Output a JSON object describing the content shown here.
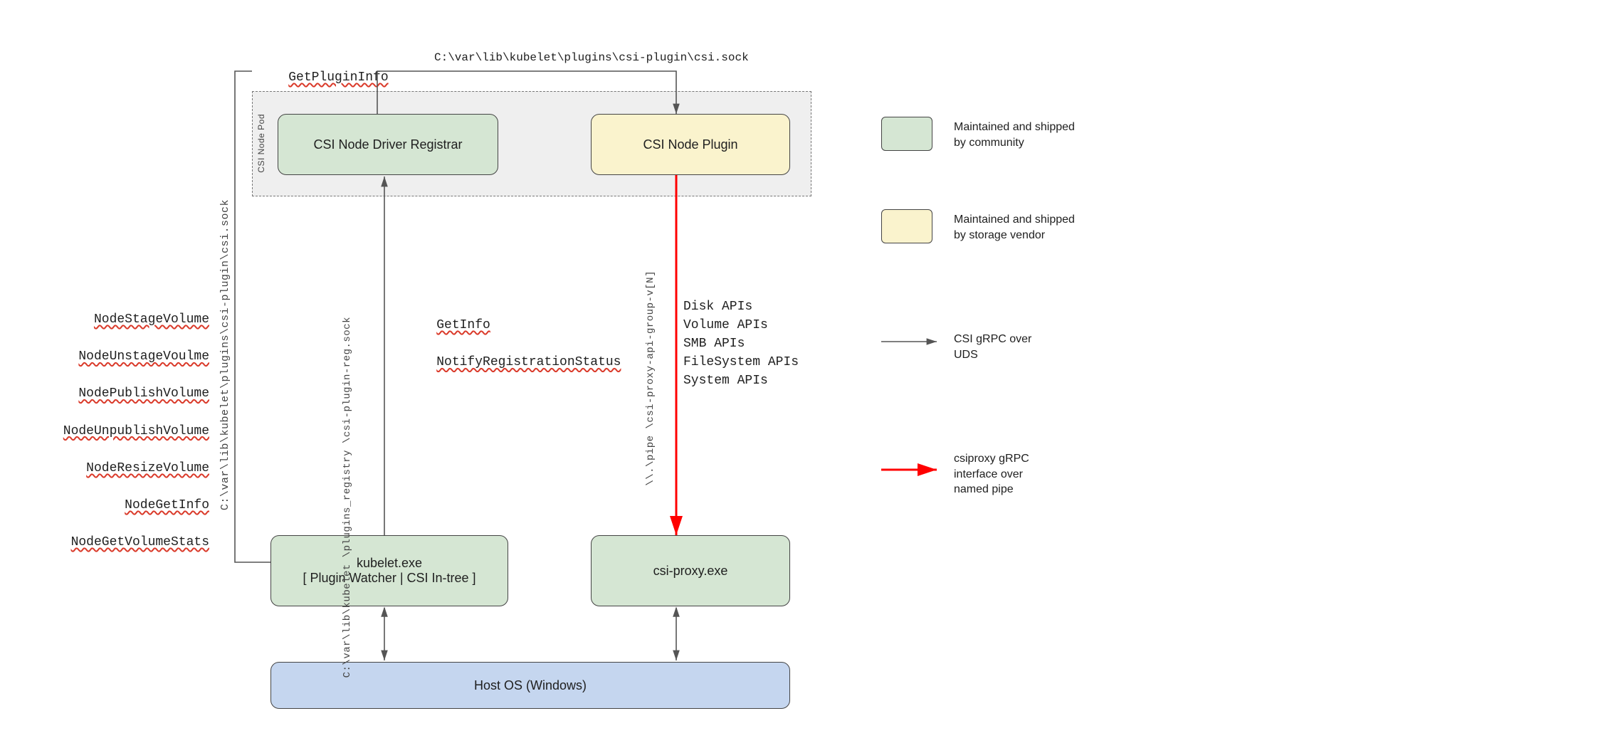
{
  "top": {
    "getPluginInfo": "GetPluginInfo",
    "sockPath": "C:\\var\\lib\\kubelet\\plugins\\csi-plugin\\csi.sock"
  },
  "pod": {
    "label": "CSI Node Pod",
    "registrar": "CSI Node Driver Registrar",
    "plugin": "CSI Node Plugin"
  },
  "left": {
    "sockPath": "C:\\var\\lib\\kubelet\\plugins\\csi-plugin\\csi.sock",
    "calls": {
      "l1": "NodeStageVolume",
      "l2": "NodeUnstageVoulme",
      "l3": "NodePublishVolume",
      "l4": "NodeUnpublishVolume",
      "l5": "NodeResizeVolume",
      "l6": "NodeGetInfo",
      "l7": "NodeGetVolumeStats"
    }
  },
  "mid": {
    "regSock": "C:\\var\\lib\\kubelet\n\\plugins_registry\n\\csi-plugin-reg.sock",
    "getInfo": "GetInfo",
    "notify": "NotifyRegistrationStatus"
  },
  "right": {
    "pipe": "\\\\.\\pipe\n\\csi-proxy-api-group-v[N]",
    "apis": "Disk APIs\nVolume APIs\nSMB APIs\nFileSystem APIs\nSystem APIs"
  },
  "bottom": {
    "kubelet_l1": "kubelet.exe",
    "kubelet_l2": "[ Plugin Watcher | CSI In-tree ]",
    "csiproxy": "csi-proxy.exe",
    "host": "Host OS (Windows)"
  },
  "legend": {
    "community": "Maintained and shipped\nby community",
    "vendor": "Maintained and shipped\nby storage vendor",
    "grpc_uds": "CSI gRPC over\nUDS",
    "grpc_pipe": "csiproxy gRPC\ninterface over\nnamed pipe"
  }
}
